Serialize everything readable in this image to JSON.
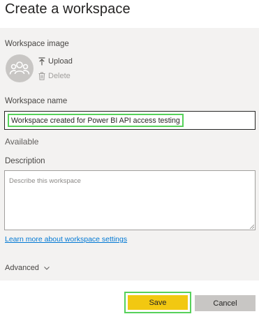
{
  "dialog": {
    "title": "Create a workspace"
  },
  "workspace_image": {
    "label": "Workspace image",
    "upload_label": "Upload",
    "delete_label": "Delete"
  },
  "workspace_name": {
    "label": "Workspace name",
    "value": "Workspace created for Power BI API access testing",
    "availability": "Available"
  },
  "description": {
    "label": "Description",
    "placeholder": "Describe this workspace",
    "value": ""
  },
  "links": {
    "learn_more": "Learn more about workspace settings"
  },
  "advanced": {
    "label": "Advanced"
  },
  "footer": {
    "save_label": "Save",
    "cancel_label": "Cancel"
  },
  "colors": {
    "accent_yellow": "#f2c811",
    "highlight_green": "#56d15a",
    "link_blue": "#0078d4",
    "panel_bg": "#f3f2f1"
  },
  "icons": [
    "group-avatar-icon",
    "upload-icon",
    "trash-icon",
    "chevron-down-icon",
    "resize-grip-icon"
  ]
}
